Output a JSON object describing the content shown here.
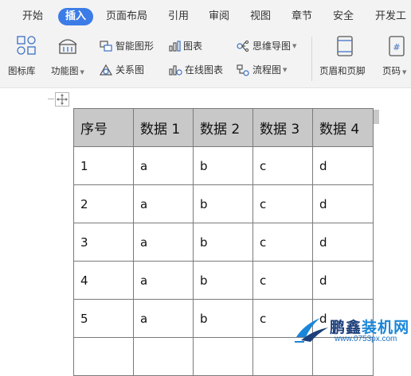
{
  "menu": {
    "tabs": [
      {
        "label": "开始",
        "active": false
      },
      {
        "label": "插入",
        "active": true
      },
      {
        "label": "页面布局",
        "active": false
      },
      {
        "label": "引用",
        "active": false
      },
      {
        "label": "审阅",
        "active": false
      },
      {
        "label": "视图",
        "active": false
      },
      {
        "label": "章节",
        "active": false
      },
      {
        "label": "安全",
        "active": false
      },
      {
        "label": "开发工",
        "active": false
      }
    ]
  },
  "ribbon": {
    "icon_library": "图标库",
    "function_chart": "功能图",
    "smart_shape": "智能图形",
    "chart": "图表",
    "mind_map": "思维导图",
    "relation_chart": "关系图",
    "online_chart": "在线图表",
    "flowchart": "流程图",
    "header_footer": "页眉和页脚",
    "page_number": "页码"
  },
  "table": {
    "headers": [
      "序号",
      "数据 1",
      "数据 2",
      "数据 3",
      "数据 4"
    ],
    "rows": [
      [
        "1",
        "a",
        "b",
        "c",
        "d"
      ],
      [
        "2",
        "a",
        "b",
        "c",
        "d"
      ],
      [
        "3",
        "a",
        "b",
        "c",
        "d"
      ],
      [
        "4",
        "a",
        "b",
        "c",
        "d"
      ],
      [
        "5",
        "a",
        "b",
        "c",
        "d"
      ],
      [
        "",
        "",
        "",
        "",
        ""
      ]
    ]
  },
  "watermark": {
    "name": "鹏鑫装机网",
    "url": "www.0753px.com"
  },
  "colors": {
    "accent": "#3b7ce6",
    "header_fill": "#c8c8c8",
    "watermark_dark": "#1c3f7a",
    "watermark_blue": "#1a86d9"
  }
}
